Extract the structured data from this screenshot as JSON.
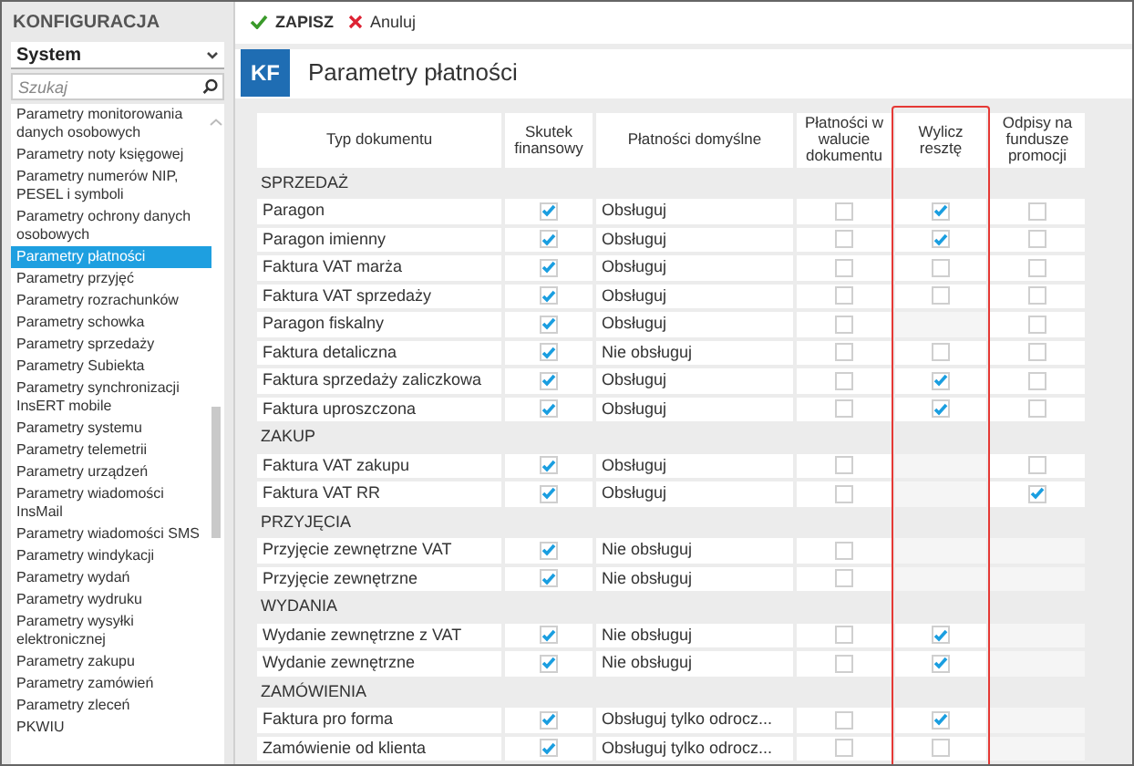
{
  "sidebar": {
    "title": "KONFIGURACJA",
    "dropdown": "System",
    "search": {
      "placeholder": "Szukaj"
    },
    "items": [
      {
        "label": "Parametry monitorowania danych osobowych",
        "selected": false
      },
      {
        "label": "Parametry noty księgowej",
        "selected": false
      },
      {
        "label": "Parametry numerów NIP, PESEL i symboli",
        "selected": false
      },
      {
        "label": "Parametry ochrony danych osobowych",
        "selected": false
      },
      {
        "label": "Parametry płatności",
        "selected": true
      },
      {
        "label": "Parametry przyjęć",
        "selected": false
      },
      {
        "label": "Parametry rozrachunków",
        "selected": false
      },
      {
        "label": "Parametry schowka",
        "selected": false
      },
      {
        "label": "Parametry sprzedaży",
        "selected": false
      },
      {
        "label": "Parametry Subiekta",
        "selected": false
      },
      {
        "label": "Parametry synchronizacji InsERT mobile",
        "selected": false
      },
      {
        "label": "Parametry systemu",
        "selected": false
      },
      {
        "label": "Parametry telemetrii",
        "selected": false
      },
      {
        "label": "Parametry urządzeń",
        "selected": false
      },
      {
        "label": "Parametry wiadomości InsMail",
        "selected": false
      },
      {
        "label": "Parametry wiadomości SMS",
        "selected": false
      },
      {
        "label": "Parametry windykacji",
        "selected": false
      },
      {
        "label": "Parametry wydań",
        "selected": false
      },
      {
        "label": "Parametry wydruku",
        "selected": false
      },
      {
        "label": "Parametry wysyłki elektronicznej",
        "selected": false
      },
      {
        "label": "Parametry zakupu",
        "selected": false
      },
      {
        "label": "Parametry zamówień",
        "selected": false
      },
      {
        "label": "Parametry zleceń",
        "selected": false
      },
      {
        "label": "PKWIU",
        "selected": false
      }
    ]
  },
  "toolbar": [
    {
      "kind": "save",
      "label": "ZAPISZ"
    },
    {
      "kind": "cancel",
      "label": "Anuluj"
    }
  ],
  "header": {
    "badge": "KF",
    "title": "Parametry płatności"
  },
  "table": {
    "columns": [
      {
        "label": "Typ dokumentu",
        "highlighted": false
      },
      {
        "label": "Skutek finansowy",
        "highlighted": false
      },
      {
        "label": "Płatności domyślne",
        "highlighted": false
      },
      {
        "label": "Płatności w walucie dokumentu",
        "highlighted": false
      },
      {
        "label": "Wylicz resztę",
        "highlighted": true
      },
      {
        "label": "Odpisy na fundusze promocji",
        "highlighted": false
      }
    ],
    "sections": [
      {
        "title": "SPRZEDAŻ",
        "rows": [
          {
            "label": "Paragon",
            "financial": true,
            "default_payment": "Obsługuj",
            "document_currency": false,
            "compute_change": true,
            "promotion_funds": false
          },
          {
            "label": "Paragon imienny",
            "financial": true,
            "default_payment": "Obsługuj",
            "document_currency": false,
            "compute_change": true,
            "promotion_funds": false
          },
          {
            "label": "Faktura VAT marża",
            "financial": true,
            "default_payment": "Obsługuj",
            "document_currency": false,
            "compute_change": false,
            "promotion_funds": false
          },
          {
            "label": "Faktura VAT sprzedaży",
            "financial": true,
            "default_payment": "Obsługuj",
            "document_currency": false,
            "compute_change": false,
            "promotion_funds": false
          },
          {
            "label": "Paragon fiskalny",
            "financial": true,
            "default_payment": "Obsługuj",
            "document_currency": false,
            "promotion_funds": false
          },
          {
            "label": "Faktura detaliczna",
            "financial": true,
            "default_payment": "Nie obsługuj",
            "document_currency": false,
            "compute_change": false,
            "promotion_funds": false
          },
          {
            "label": "Faktura sprzedaży zaliczkowa",
            "financial": true,
            "default_payment": "Obsługuj",
            "document_currency": false,
            "compute_change": true,
            "promotion_funds": false
          },
          {
            "label": "Faktura uproszczona",
            "financial": true,
            "default_payment": "Obsługuj",
            "document_currency": false,
            "compute_change": true,
            "promotion_funds": false
          }
        ]
      },
      {
        "title": "ZAKUP",
        "rows": [
          {
            "label": "Faktura VAT zakupu",
            "financial": true,
            "default_payment": "Obsługuj",
            "document_currency": false,
            "promotion_funds": false
          },
          {
            "label": "Faktura VAT RR",
            "financial": true,
            "default_payment": "Obsługuj",
            "document_currency": false,
            "promotion_funds": true
          }
        ]
      },
      {
        "title": "PRZYJĘCIA",
        "rows": [
          {
            "label": "Przyjęcie zewnętrzne VAT",
            "financial": true,
            "default_payment": "Nie obsługuj",
            "document_currency": false
          },
          {
            "label": "Przyjęcie zewnętrzne",
            "financial": true,
            "default_payment": "Nie obsługuj",
            "document_currency": false
          }
        ]
      },
      {
        "title": "WYDANIA",
        "rows": [
          {
            "label": "Wydanie zewnętrzne z VAT",
            "financial": true,
            "default_payment": "Nie obsługuj",
            "document_currency": false,
            "compute_change": true
          },
          {
            "label": "Wydanie zewnętrzne",
            "financial": true,
            "default_payment": "Nie obsługuj",
            "document_currency": false,
            "compute_change": true
          }
        ]
      },
      {
        "title": "ZAMÓWIENIA",
        "rows": [
          {
            "label": "Faktura pro forma",
            "financial": true,
            "default_payment": "Obsługuj tylko odrocz...",
            "document_currency": false,
            "compute_change": true
          },
          {
            "label": "Zamówienie od klienta",
            "financial": true,
            "default_payment": "Obsługuj tylko odrocz...",
            "document_currency": false,
            "compute_change": false
          }
        ]
      }
    ]
  }
}
